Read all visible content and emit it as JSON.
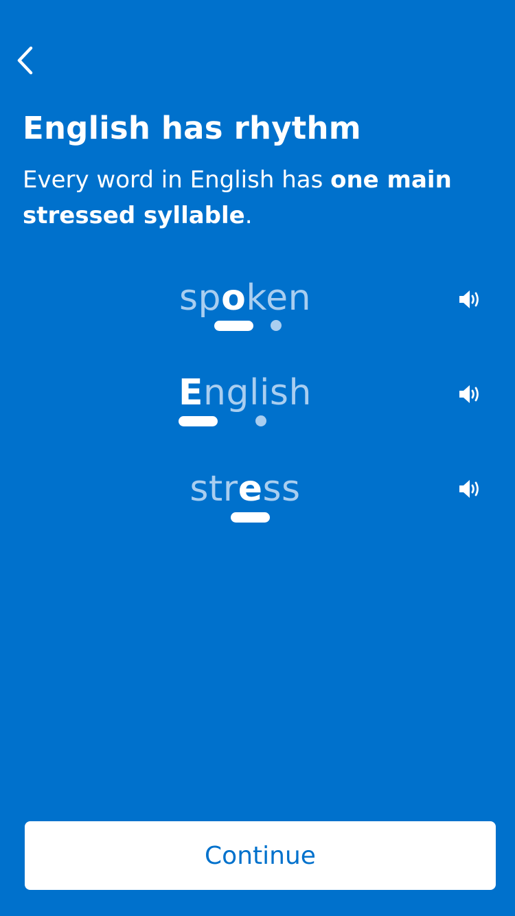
{
  "header": {
    "back_icon": "chevron-left-icon",
    "title": "English has rhythm"
  },
  "intro": {
    "text_before": "Every word in English has ",
    "text_bold": "one main stressed syllable",
    "text_after": "."
  },
  "words": [
    {
      "word": "spoken",
      "segments": [
        {
          "text": "sp",
          "stressed": false
        },
        {
          "text": "o",
          "stressed": true
        },
        {
          "text": "ken",
          "stressed": false
        }
      ],
      "rhythm": [
        "stressed",
        "unstressed"
      ],
      "audio_icon": "speaker-icon"
    },
    {
      "word": "English",
      "segments": [
        {
          "text": "E",
          "stressed": true
        },
        {
          "text": "nglish",
          "stressed": false
        }
      ],
      "rhythm": [
        "stressed",
        "unstressed"
      ],
      "audio_icon": "speaker-icon"
    },
    {
      "word": "stress",
      "segments": [
        {
          "text": "str",
          "stressed": false
        },
        {
          "text": "e",
          "stressed": true
        },
        {
          "text": "ss",
          "stressed": false
        }
      ],
      "rhythm": [
        "stressed"
      ],
      "audio_icon": "speaker-icon"
    }
  ],
  "footer": {
    "continue_label": "Continue"
  },
  "colors": {
    "background": "#0071CC",
    "stressed": "#FFFFFF",
    "unstressed": "#A9CEF0",
    "button_text": "#0071CC"
  }
}
